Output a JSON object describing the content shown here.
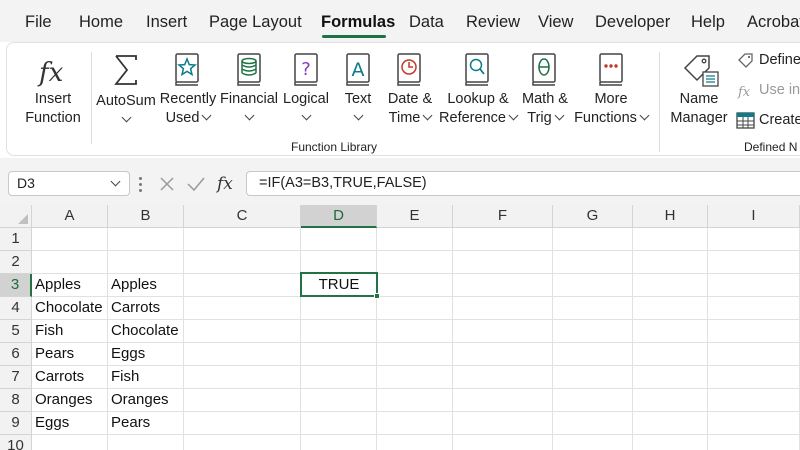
{
  "menu": {
    "tabs": [
      "File",
      "Home",
      "Insert",
      "Page Layout",
      "Formulas",
      "Data",
      "Review",
      "View",
      "Developer",
      "Help",
      "Acrobat"
    ],
    "active_tab": "Formulas"
  },
  "ribbon": {
    "insert_function": {
      "line1": "Insert",
      "line2": "Function",
      "icon": "fx-icon"
    },
    "autosum": {
      "line1": "AutoSum",
      "icon": "sigma-icon"
    },
    "recently_used": {
      "line1": "Recently",
      "line2": "Used",
      "icon": "star-book-icon"
    },
    "financial": {
      "line1": "Financial",
      "icon": "coins-book-icon"
    },
    "logical": {
      "line1": "Logical",
      "icon": "question-book-icon"
    },
    "text": {
      "line1": "Text",
      "icon": "letter-a-book-icon"
    },
    "date_time": {
      "line1": "Date &",
      "line2": "Time",
      "icon": "clock-book-icon"
    },
    "lookup_reference": {
      "line1": "Lookup &",
      "line2": "Reference",
      "icon": "magnifier-book-icon"
    },
    "math_trig": {
      "line1": "Math &",
      "line2": "Trig",
      "icon": "theta-book-icon"
    },
    "more_functions": {
      "line1": "More",
      "line2": "Functions",
      "icon": "dots-book-icon"
    },
    "function_library_label": "Function Library",
    "name_manager": {
      "line1": "Name",
      "line2": "Manager",
      "icon": "tag-icon"
    },
    "define_name": "Define",
    "use_in_formula": "Use in",
    "create_from_selection": "Create",
    "defined_names_label": "Defined N"
  },
  "formula_bar": {
    "name_box": "D3",
    "formula": "=IF(A3=B3,TRUE,FALSE)"
  },
  "grid": {
    "columns": [
      "A",
      "B",
      "C",
      "D",
      "E",
      "F",
      "G",
      "H",
      "I"
    ],
    "rows": [
      "1",
      "2",
      "3",
      "4",
      "5",
      "6",
      "7",
      "8",
      "9",
      "10"
    ],
    "selected_column": "D",
    "selected_row": "3",
    "column_a": [
      "",
      "",
      "Apples",
      "Chocolate",
      "Fish",
      "Pears",
      "Carrots",
      "Oranges",
      "Eggs",
      ""
    ],
    "column_b": [
      "",
      "",
      "Apples",
      "Carrots",
      "Chocolate",
      "Eggs",
      "Fish",
      "Oranges",
      "Pears",
      ""
    ],
    "d3": "TRUE"
  },
  "colors": {
    "accent": "#217346",
    "tab_underline": "#1e7145",
    "ribbon_icon_teal": "#0a7c8a",
    "ribbon_icon_green": "#1e7145",
    "ribbon_icon_purple": "#8a3ab9",
    "ribbon_icon_red": "#c0392b"
  }
}
